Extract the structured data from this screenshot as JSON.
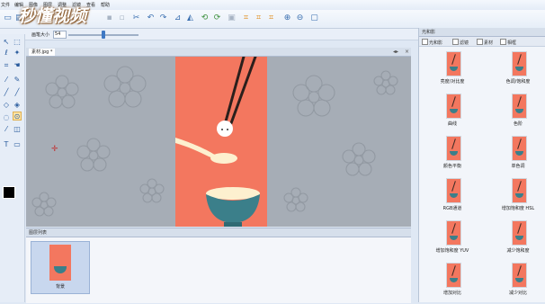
{
  "menu": [
    "文件",
    "编辑",
    "图像",
    "图层",
    "调整",
    "滤镜",
    "查看",
    "帮助"
  ],
  "watermark": "秒懂视频",
  "options": {
    "brush_size_label": "画笔大小",
    "brush_size_value": "54",
    "brush_size_fraction": 0.47
  },
  "document": {
    "tab_label": "素材.jpg *"
  },
  "right_panel": {
    "title": "光和影",
    "tabs": [
      "光和影",
      "滤镜",
      "素材",
      "相框"
    ],
    "effects": [
      "亮度/对比度",
      "色调/饱和度",
      "曲线",
      "色阶",
      "颜色平衡",
      "单色调",
      "RGB通道",
      "增加饱和度 HSL",
      "增加饱和度 YUV",
      "减少饱和度",
      "增加对比",
      "减少对比"
    ]
  },
  "layers": {
    "title": "图层列表",
    "items": [
      {
        "name": "背景"
      }
    ]
  },
  "colors": {
    "canvas_bg": "#f3775f",
    "bowl": "#3b7f8a",
    "chopstick": "#2b1f1c",
    "accent": "#3f79c4"
  }
}
